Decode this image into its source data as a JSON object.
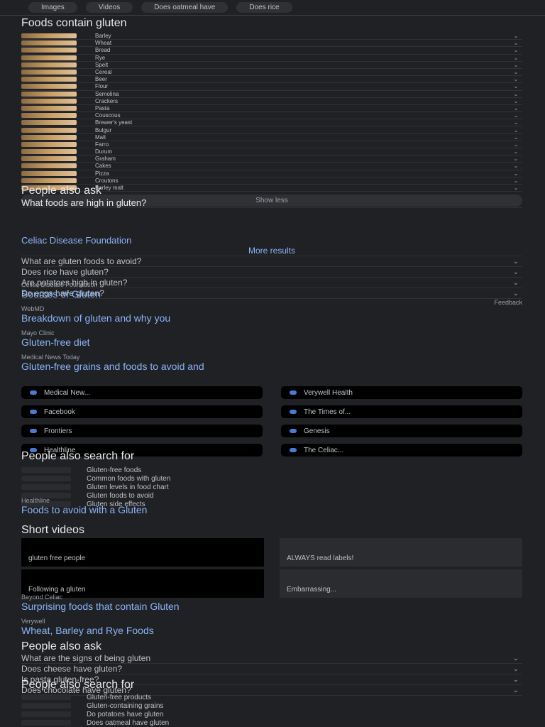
{
  "header": {
    "tabs": [
      "Images",
      "Videos",
      "Does oatmeal have",
      "Does rice"
    ]
  },
  "section1": {
    "title": "Foods contain gluten",
    "items": [
      "Barley",
      "Wheat",
      "Bread",
      "Rye",
      "Spelt",
      "Cereal",
      "Beer",
      "Flour",
      "Semolina",
      "Crackers",
      "Pasta",
      "Couscous",
      "Brewer's yeast",
      "Bulgur",
      "Malt",
      "Farro",
      "Durum",
      "Graham",
      "Cakes",
      "Pizza",
      "Croutons",
      "Barley malt"
    ],
    "show_less": "Show less"
  },
  "paa1": {
    "title": "People also ask",
    "expanded_q": "What foods are high in gluten?",
    "source": "Celiac Disease Foundation",
    "more": "More results",
    "questions": [
      "What are gluten foods to avoid?",
      "Does rice have gluten?",
      "Are potatoes high in gluten?",
      "Do eggs have gluten?"
    ],
    "feedback": "Feedback"
  },
  "results": [
    {
      "site": "Celiac Disease Foundation",
      "title": "Sources of Gluten"
    },
    {
      "site": "WebMD",
      "title": "Breakdown of gluten and why you"
    },
    {
      "site": "Mayo Clinic",
      "title": "Gluten-free diet"
    },
    {
      "site": "Medical News Today",
      "title": "Gluten-free grains and foods to avoid and"
    }
  ],
  "pills": [
    "Medical New...",
    "Verywell Health",
    "Facebook",
    "The Times of...",
    "Frontiers",
    "Genesis",
    "Healthline",
    "The Celiac..."
  ],
  "pase1": {
    "title": "People also search for",
    "items": [
      "Gluten-free foods",
      "Common foods with gluten",
      "Gluten levels in food chart",
      "Gluten foods to avoid",
      "Gluten side effects"
    ]
  },
  "result5": {
    "site": "Healthline",
    "title": "Foods to avoid with a Gluten"
  },
  "short_videos": {
    "title": "Short videos",
    "items": [
      "gluten free people",
      "ALWAYS read labels!",
      "Following a gluten",
      "Embarrassing..."
    ]
  },
  "result6": {
    "site": "Beyond Celiac",
    "title": "Surprising foods that contain Gluten"
  },
  "result7": {
    "site": "Verywell",
    "title": "Wheat, Barley and Rye Foods"
  },
  "paa2": {
    "title": "People also ask",
    "questions": [
      "What are the signs of being gluten",
      "Does cheese have gluten?",
      "Is pasta gluten-free?",
      "Does chocolate have gluten?"
    ]
  },
  "pase2": {
    "title": "People also search for",
    "items": [
      "Gluten-free products",
      "Gluten-containing grains",
      "Do potatoes have gluten",
      "Does oatmeal have gluten"
    ]
  }
}
